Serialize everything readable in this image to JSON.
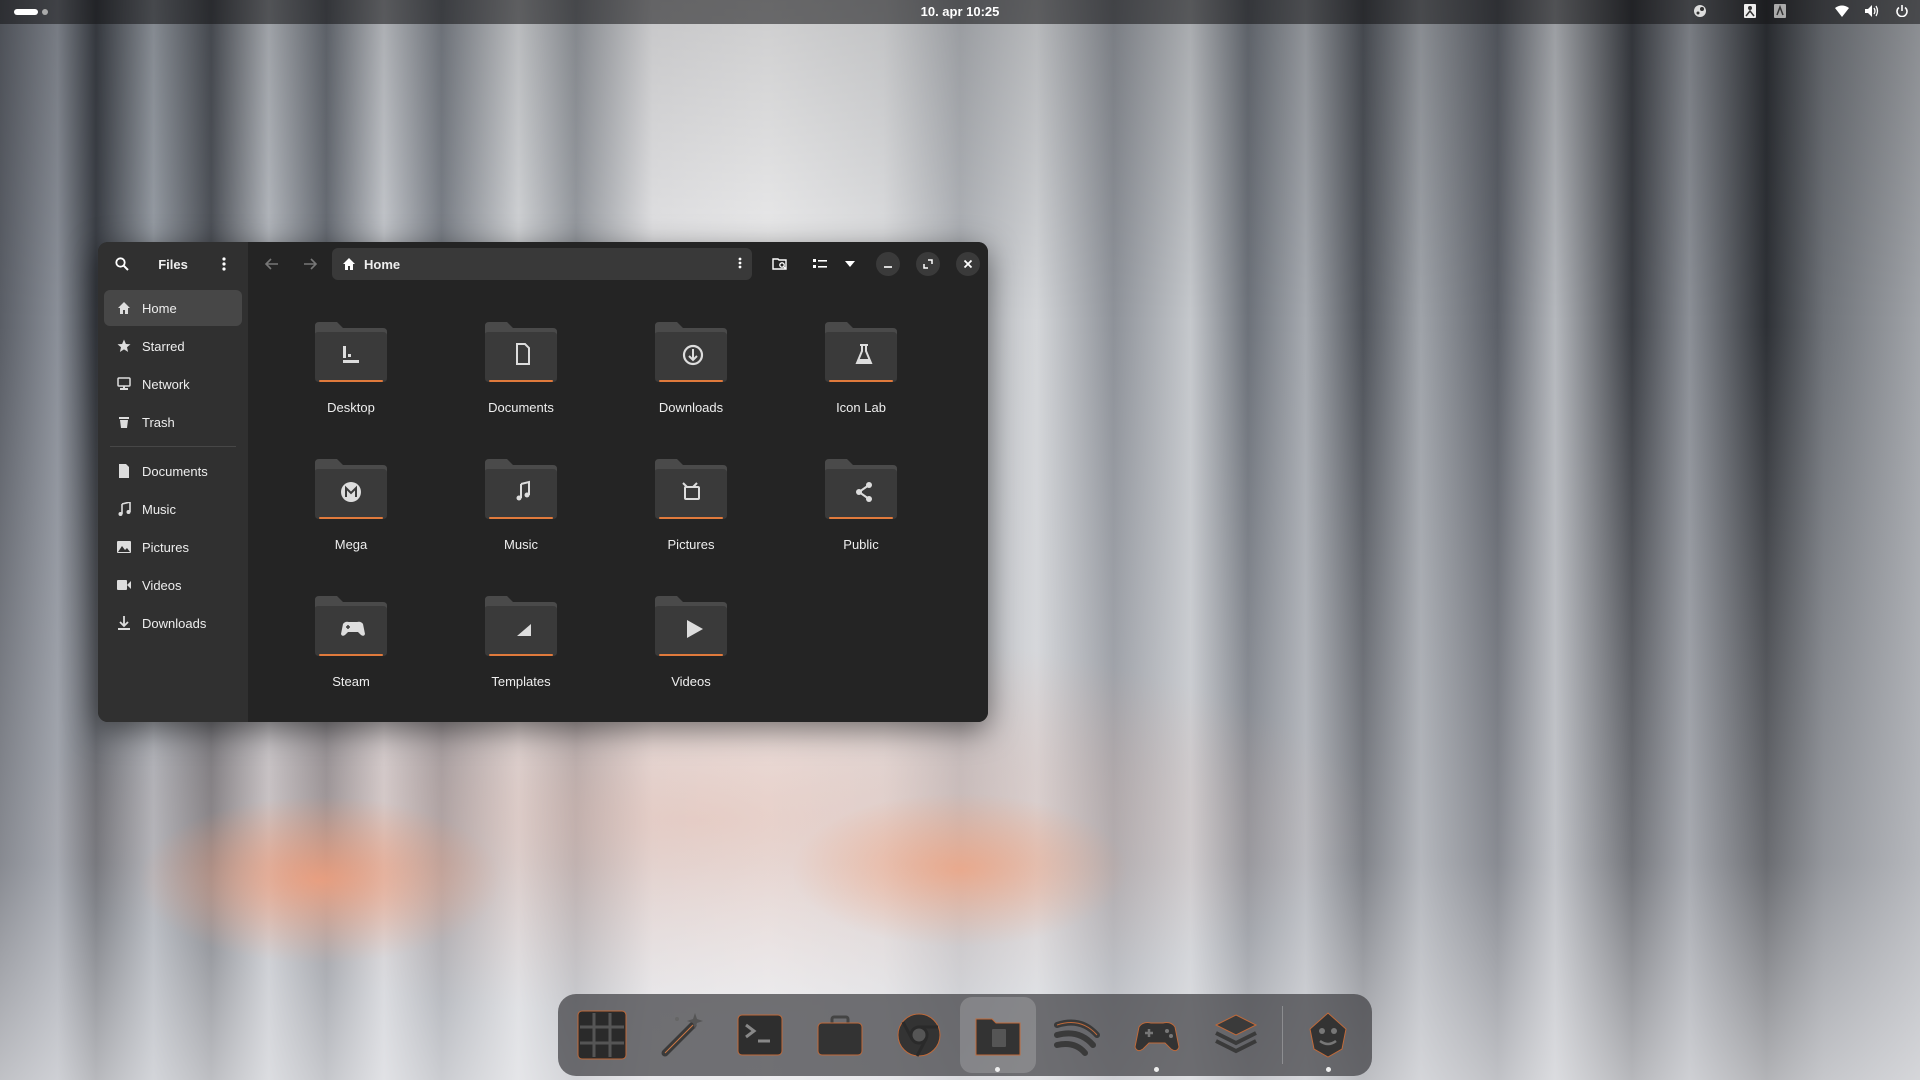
{
  "topbar": {
    "clock": "10. apr  10:25",
    "tray_icons": [
      "steam-icon",
      "accessibility-icon",
      "keyboard-layout-icon",
      "wifi-icon",
      "volume-icon",
      "power-icon"
    ]
  },
  "window": {
    "sidebar": {
      "title": "Files",
      "places": [
        {
          "label": "Home",
          "icon": "home-icon",
          "active": true
        },
        {
          "label": "Starred",
          "icon": "star-icon"
        },
        {
          "label": "Network",
          "icon": "network-icon"
        },
        {
          "label": "Trash",
          "icon": "trash-icon"
        }
      ],
      "bookmarks": [
        {
          "label": "Documents",
          "icon": "document-icon"
        },
        {
          "label": "Music",
          "icon": "music-icon"
        },
        {
          "label": "Pictures",
          "icon": "picture-icon"
        },
        {
          "label": "Videos",
          "icon": "video-icon"
        },
        {
          "label": "Downloads",
          "icon": "download-icon"
        }
      ]
    },
    "pathbar": {
      "label": "Home"
    },
    "folders": [
      {
        "name": "Desktop",
        "emblem": "desktop"
      },
      {
        "name": "Documents",
        "emblem": "document"
      },
      {
        "name": "Downloads",
        "emblem": "download"
      },
      {
        "name": "Icon Lab",
        "emblem": "flask"
      },
      {
        "name": "Mega",
        "emblem": "mega"
      },
      {
        "name": "Music",
        "emblem": "music"
      },
      {
        "name": "Pictures",
        "emblem": "pictures"
      },
      {
        "name": "Public",
        "emblem": "share"
      },
      {
        "name": "Steam",
        "emblem": "gamepad"
      },
      {
        "name": "Templates",
        "emblem": "template"
      },
      {
        "name": "Videos",
        "emblem": "video"
      }
    ]
  },
  "dock": {
    "items": [
      "app-grid-icon",
      "magic-wand-icon",
      "terminal-icon",
      "briefcase-icon",
      "browser-icon",
      "files-icon",
      "stream-icon",
      "gamepad-icon",
      "layers-icon",
      "mascot-icon"
    ]
  },
  "colors": {
    "accent": "#e07a3c",
    "window_bg": "#242424",
    "sidebar_bg": "#303030"
  }
}
